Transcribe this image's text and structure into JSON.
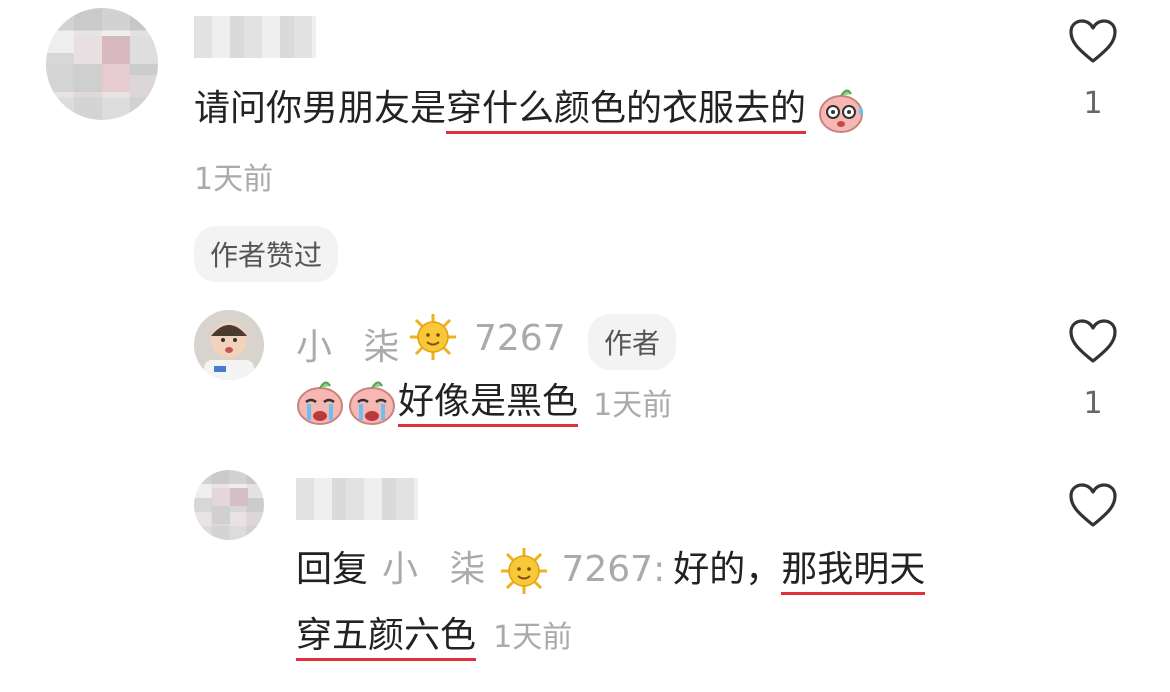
{
  "comments": [
    {
      "text_plain": "请问你男朋友是",
      "text_underlined": "穿什么颜色的衣服去的",
      "emoji": "sweat-face-emoji",
      "time": "1天前",
      "badge": "作者赞过",
      "likes": "1"
    }
  ],
  "replies": [
    {
      "username": "小 柒",
      "level_icon": "sun-emoji",
      "level": "7267",
      "author_tag": "作者",
      "emoji": "crying-face-emoji",
      "text_underlined": "好像是黑色",
      "time": "1天前",
      "likes": "1"
    },
    {
      "reply_prefix": "回复",
      "reply_to": "小 柒",
      "level_icon": "sun-emoji",
      "level": "7267:",
      "text_plain": "好的，",
      "text_underlined_1": "那我明天",
      "text_underlined_2": "穿五颜六色",
      "time": "1天前"
    }
  ],
  "colors": {
    "underline": "#e0313b",
    "meta": "#aaaaaa",
    "text": "#222222"
  }
}
